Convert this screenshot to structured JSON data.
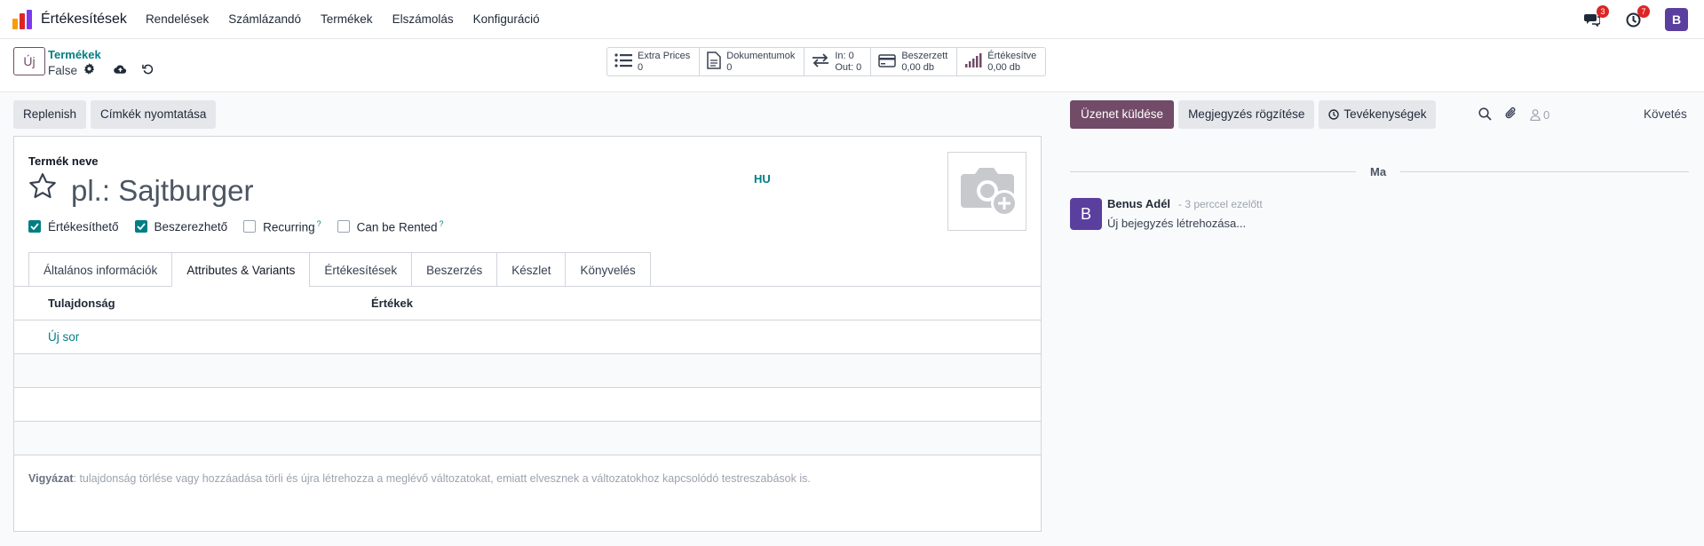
{
  "navbar": {
    "app_title": "Értékesítések",
    "menu": [
      "Rendelések",
      "Számlázandó",
      "Termékek",
      "Elszámolás",
      "Konfiguráció"
    ],
    "messages_badge": "3",
    "activities_badge": "7",
    "user_initial": "B"
  },
  "control": {
    "new_button": "Új",
    "breadcrumb": "Termékek",
    "record_name": "False",
    "stats": [
      {
        "icon": "list-icon",
        "line1": "Extra Prices",
        "line2": "0"
      },
      {
        "icon": "document-icon",
        "line1": "Dokumentumok",
        "line2": "0"
      },
      {
        "icon": "transfer-icon",
        "line1": "In: 0",
        "line2": "Out: 0"
      },
      {
        "icon": "credit-card-icon",
        "line1": "Beszerzett",
        "line2": "0,00 db"
      },
      {
        "icon": "signal-bars-icon",
        "line1": "Értékesítve",
        "line2": "0,00 db"
      }
    ]
  },
  "form": {
    "buttons": [
      "Replenish",
      "Címkék nyomtatása"
    ],
    "name_label": "Termék neve",
    "name_placeholder": "pl.: Sajtburger",
    "lang": "HU",
    "checkboxes": [
      {
        "label": "Értékesíthető",
        "checked": true,
        "help": ""
      },
      {
        "label": "Beszerezhető",
        "checked": true,
        "help": ""
      },
      {
        "label": "Recurring",
        "checked": false,
        "help": "?"
      },
      {
        "label": "Can be Rented",
        "checked": false,
        "help": "?"
      }
    ],
    "tabs": [
      "Általános információk",
      "Attributes & Variants",
      "Értékesítések",
      "Beszerzés",
      "Készlet",
      "Könyvelés"
    ],
    "active_tab": "Attributes & Variants",
    "table_headers": [
      "Tulajdonság",
      "Értékek"
    ],
    "add_line": "Új sor",
    "warning_bold": "Vigyázat",
    "warning_text": ": tulajdonság törlése vagy hozzáadása törli és újra létrehozza a meglévő változatokat, emiatt elvesznek a változatokhoz kapcsolódó testreszabások is."
  },
  "chatter": {
    "send_message": "Üzenet küldése",
    "log_note": "Megjegyzés rögzítése",
    "activities": "Tevékenységek",
    "followers_count": "0",
    "follow": "Követés",
    "date_separator": "Ma",
    "message": {
      "avatar": "B",
      "author": "Benus Adél",
      "date": "- 3 perccel ezelőtt",
      "body": "Új bejegyzés létrehozása..."
    }
  },
  "colors": {
    "primary": "#714b67",
    "link": "#017e84",
    "avatar": "#5b3f9e",
    "badge": "#dc2626"
  }
}
